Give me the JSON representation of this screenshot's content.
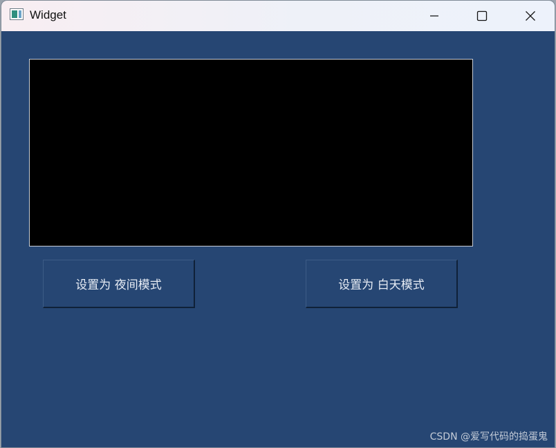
{
  "window": {
    "title": "Widget"
  },
  "buttons": {
    "night_label": "设置为 夜间模式",
    "day_label": "设置为 白天模式"
  },
  "watermark": "CSDN @爱写代码的捣蛋鬼",
  "colors": {
    "window_background": "#264673",
    "display_background": "#000000",
    "button_text": "#e8edf5"
  },
  "icons": {
    "app": "app-window-icon",
    "minimize": "minimize-icon",
    "maximize": "maximize-icon",
    "close": "close-icon"
  }
}
